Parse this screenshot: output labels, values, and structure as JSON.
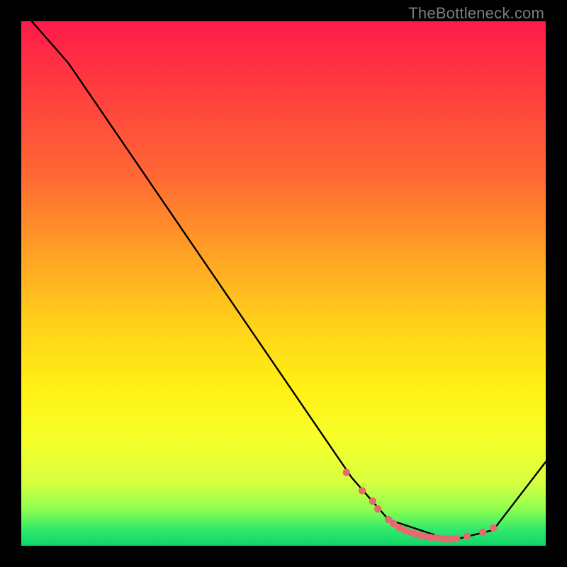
{
  "watermark": "TheBottleneck.com",
  "chart_data": {
    "type": "line",
    "title": "",
    "xlabel": "",
    "ylabel": "",
    "xlim": [
      0,
      100
    ],
    "ylim": [
      0,
      100
    ],
    "series": [
      {
        "name": "curve",
        "x": [
          2,
          9,
          63,
          70,
          82,
          90,
          100
        ],
        "y": [
          100,
          92,
          13,
          5,
          1,
          3,
          16
        ]
      }
    ],
    "markers": {
      "name": "dots",
      "color": "#e46a6f",
      "x": [
        62,
        65,
        67,
        68,
        70,
        71,
        72,
        73,
        74,
        75,
        76,
        77,
        78,
        79,
        80,
        81,
        82,
        83,
        85,
        88,
        90
      ],
      "y": [
        14,
        10.5,
        8.5,
        7,
        5,
        4.2,
        3.5,
        3,
        2.6,
        2.3,
        2.0,
        1.8,
        1.6,
        1.5,
        1.4,
        1.3,
        1.3,
        1.4,
        1.8,
        2.6,
        3.4
      ]
    }
  }
}
